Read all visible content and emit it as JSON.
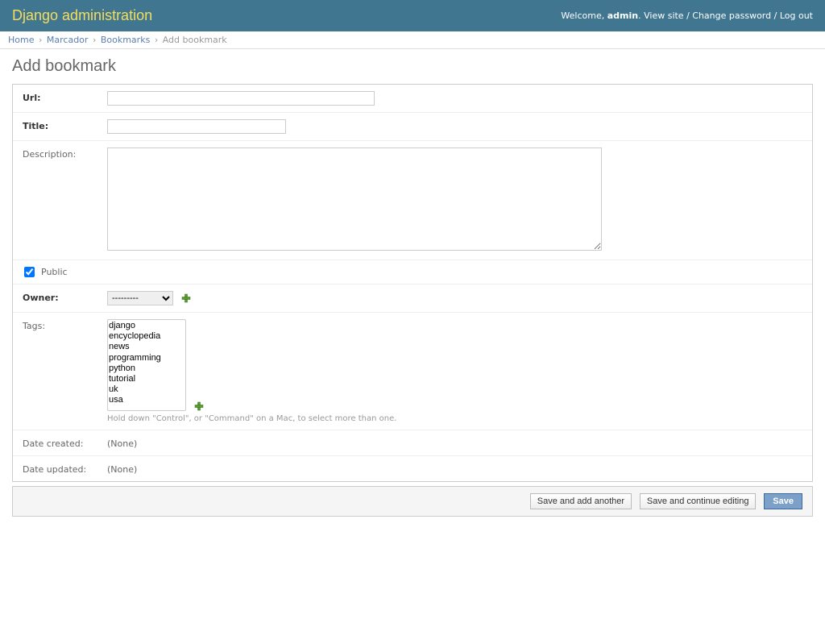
{
  "header": {
    "branding": "Django administration",
    "welcome": "Welcome,",
    "username": "admin",
    "view_site": "View site",
    "change_password": "Change password",
    "log_out": "Log out"
  },
  "breadcrumbs": {
    "home": "Home",
    "app": "Marcador",
    "model": "Bookmarks",
    "current": "Add bookmark"
  },
  "page_title": "Add bookmark",
  "fields": {
    "url": {
      "label": "Url:"
    },
    "title": {
      "label": "Title:"
    },
    "description": {
      "label": "Description:"
    },
    "public": {
      "label": "Public"
    },
    "owner": {
      "label": "Owner:",
      "placeholder": "---------"
    },
    "tags": {
      "label": "Tags:",
      "options": [
        "django",
        "encyclopedia",
        "news",
        "programming",
        "python",
        "tutorial",
        "uk",
        "usa"
      ],
      "help": "Hold down \"Control\", or \"Command\" on a Mac, to select more than one."
    },
    "date_created": {
      "label": "Date created:",
      "value": "(None)"
    },
    "date_updated": {
      "label": "Date updated:",
      "value": "(None)"
    }
  },
  "buttons": {
    "save_add_another": "Save and add another",
    "save_continue": "Save and continue editing",
    "save": "Save"
  }
}
